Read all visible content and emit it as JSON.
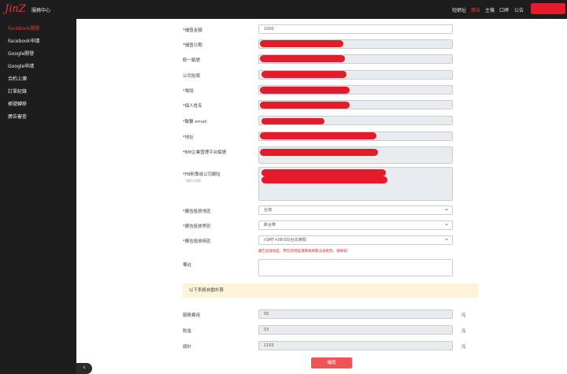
{
  "header": {
    "logo": "JinZ",
    "service_center": "服務中心",
    "nav": [
      {
        "label": "短網址",
        "active": false
      },
      {
        "label": "廣告",
        "active": true
      },
      {
        "label": "主機",
        "active": false
      },
      {
        "label": "口碑",
        "active": false
      },
      {
        "label": "公告",
        "active": false
      }
    ]
  },
  "sidebar": {
    "items": [
      {
        "label": "Facebook開發",
        "active": true
      },
      {
        "label": "Facebook申請",
        "active": false
      },
      {
        "label": "Google開發",
        "active": false
      },
      {
        "label": "Google申請",
        "active": false
      },
      {
        "label": "合約上傳",
        "active": false
      },
      {
        "label": "訂單紀錄",
        "active": false
      },
      {
        "label": "帳號轉移",
        "active": false
      },
      {
        "label": "廣告審查",
        "active": false
      }
    ],
    "collapse_icon": "‹"
  },
  "form": {
    "labels": {
      "amount": "*儲值金額",
      "date": "*儲值日期",
      "tax_id": "統一編號",
      "company": "公司抬頭",
      "phone": "*電話",
      "contact": "*個人姓名",
      "email": "*聯繫 email",
      "address": "*地址",
      "bm": "*BM企業管理平台編號",
      "fb_page": "*FB粉專或公司網址",
      "fb_page_note": "(換行分隔)",
      "region": "*廣告投放地區",
      "currency": "*廣告投放幣別",
      "timezone": "*廣告投放時區",
      "remark": "備註"
    },
    "values": {
      "amount": "1000",
      "region": "台灣",
      "currency": "新台幣",
      "timezone": "(GMT+08:00)台北時間"
    },
    "notice": "廣告投放地區、幣別及時區選擇後將無法再更改，請填寫！",
    "auto_calc_title": "以下系統自動計算",
    "fees": [
      {
        "label": "服務費用",
        "value": "50",
        "unit": "元"
      },
      {
        "label": "稅金",
        "value": "53",
        "unit": "元"
      },
      {
        "label": "總計",
        "value": "1103",
        "unit": "元"
      }
    ],
    "submit_label": "確認"
  },
  "colors": {
    "accent": "#e53935",
    "redact": "#e31b2b",
    "dark": "#1d1d1d"
  }
}
